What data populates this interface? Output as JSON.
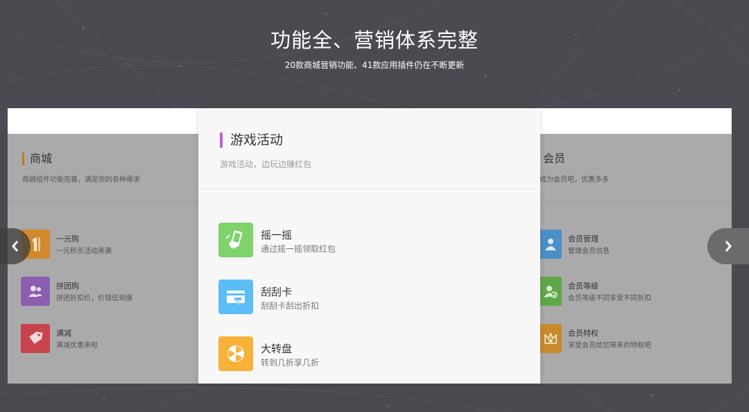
{
  "hero": {
    "title": "功能全、营销体系完整",
    "subtitle": "20款商城营销功能、41款应用插件仍在不断更新"
  },
  "colors": {
    "background": "#4a4b50",
    "center_accent": "#c75ee0",
    "mall_accent": "#c07a1a"
  },
  "left_card": {
    "title": "商城",
    "desc": "商城组件功能完善，满足你的各种需求",
    "items": [
      {
        "title": "一元购",
        "desc": "一元秒杀活动来袭",
        "icon": "number-one-icon",
        "color": "#d08a2a"
      },
      {
        "title": "拼团购",
        "desc": "拼团折扣价，价钱低到爆",
        "icon": "group-people-icon",
        "color": "#8a5fb0"
      },
      {
        "title": "满减",
        "desc": "满减优惠来啦",
        "icon": "price-tag-icon",
        "color": "#c9434c"
      }
    ]
  },
  "center_card": {
    "title": "游戏活动",
    "desc": "游戏活动，边玩边赚红包",
    "items": [
      {
        "title": "摇一摇",
        "desc": "通过摇一摇领取红包",
        "icon": "shake-phone-icon",
        "color": "#7ed36b"
      },
      {
        "title": "刮刮卡",
        "desc": "刮刮卡刮出折扣",
        "icon": "scratch-card-icon",
        "color": "#5cbef5"
      },
      {
        "title": "大转盘",
        "desc": "转到几折享几折",
        "icon": "wheel-icon",
        "color": "#f7b23a"
      }
    ]
  },
  "right_card": {
    "title": "会员",
    "desc": "成为会员吧，优惠多多",
    "items": [
      {
        "title": "会员管理",
        "desc": "管理会员信息",
        "icon": "member-icon",
        "color": "#4b8fc9"
      },
      {
        "title": "会员等级",
        "desc": "会员等级不同享受不同折扣",
        "icon": "member-level-icon",
        "color": "#5fa84a"
      },
      {
        "title": "会员特权",
        "desc": "享受会员给您带来的特权吧",
        "icon": "crown-star-icon",
        "color": "#c98a2a"
      }
    ]
  },
  "nav": {
    "prev_icon": "chevron-left-icon",
    "next_icon": "chevron-right-icon"
  }
}
